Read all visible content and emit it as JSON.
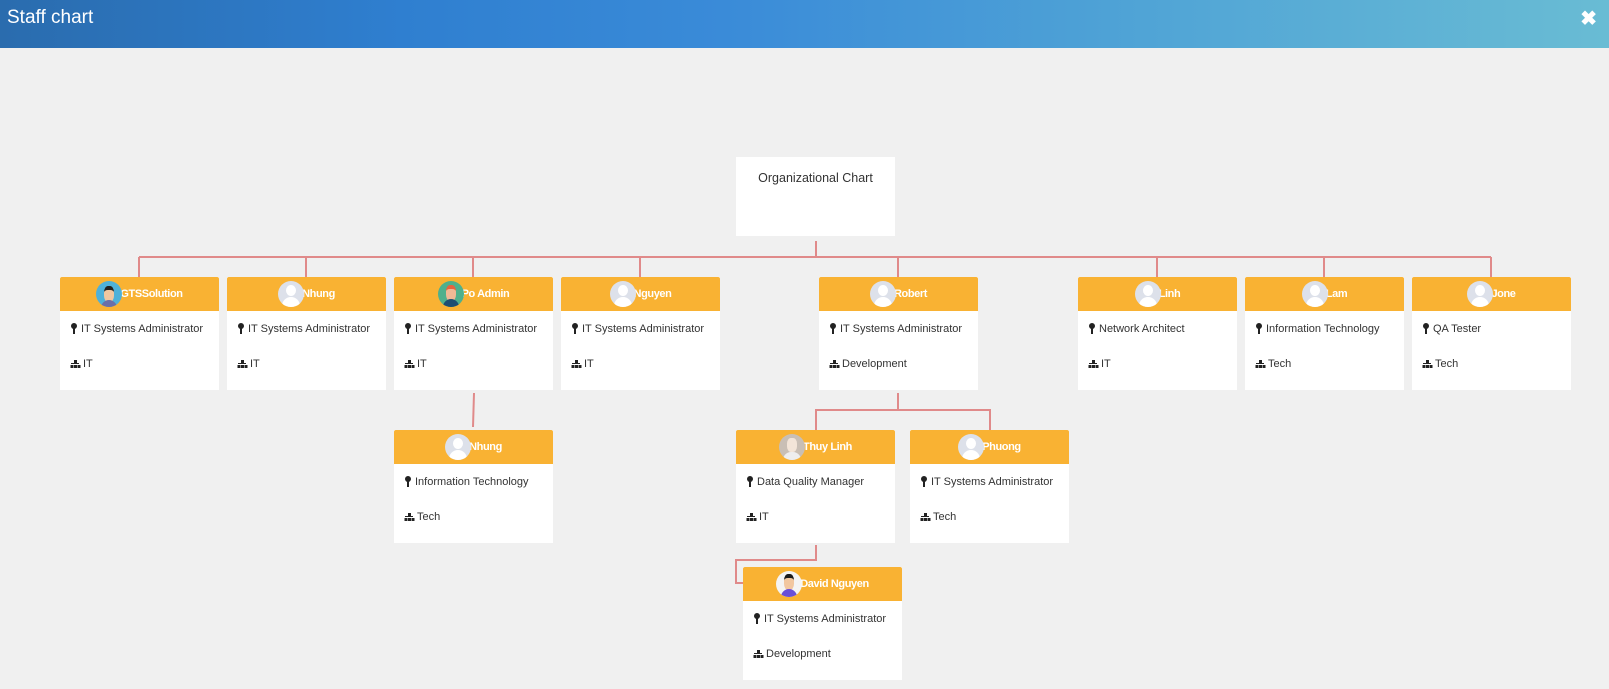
{
  "window": {
    "title": "Staff chart",
    "close_icon": "close-icon"
  },
  "chart": {
    "root_label": "Organizational Chart",
    "line_color": "#e08a8a",
    "header_color": "#f9b233",
    "nodes": [
      {
        "name": "GTSSolution",
        "title": "IT Systems Administrator",
        "department": "IT",
        "avatar": "illustrated-avatar"
      },
      {
        "name": "Nhung",
        "title": "IT Systems Administrator",
        "department": "IT",
        "avatar": "default-avatar"
      },
      {
        "name": "Po Admin",
        "title": "IT Systems Administrator",
        "department": "IT",
        "avatar": "illustrated-avatar"
      },
      {
        "name": "Nguyen",
        "title": "IT Systems Administrator",
        "department": "IT",
        "avatar": "default-avatar"
      },
      {
        "name": "Robert",
        "title": "IT Systems Administrator",
        "department": "Development",
        "avatar": "default-avatar"
      },
      {
        "name": "Linh",
        "title": "Network Architect",
        "department": "IT",
        "avatar": "default-avatar"
      },
      {
        "name": "Lam",
        "title": "Information Technology",
        "department": "Tech",
        "avatar": "default-avatar"
      },
      {
        "name": "Jone",
        "title": "QA Tester",
        "department": "Tech",
        "avatar": "default-avatar"
      },
      {
        "name": "Nhung",
        "title": "Information Technology",
        "department": "Tech",
        "avatar": "default-avatar",
        "parent": "Po Admin"
      },
      {
        "name": "Thuy Linh",
        "title": "Data Quality Manager",
        "department": "IT",
        "avatar": "photo-avatar",
        "parent": "Robert"
      },
      {
        "name": "Phuong",
        "title": "IT Systems Administrator",
        "department": "Tech",
        "avatar": "default-avatar",
        "parent": "Robert"
      },
      {
        "name": "David Nguyen",
        "title": "IT Systems Administrator",
        "department": "Development",
        "avatar": "illustrated-avatar",
        "parent": "Thuy Linh"
      }
    ]
  }
}
